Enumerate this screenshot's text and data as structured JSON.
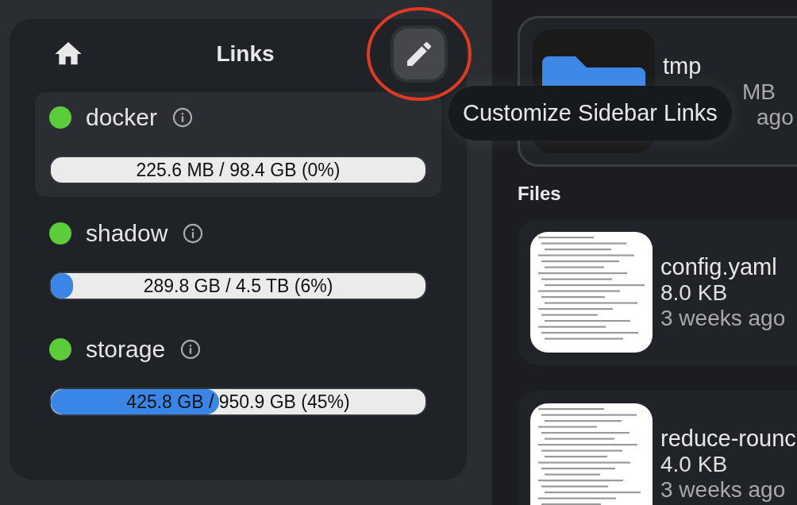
{
  "sidebar": {
    "title": "Links",
    "sources": [
      {
        "name": "docker",
        "online": true,
        "hovered": true,
        "usage": "225.6 MB / 98.4 GB (0%)",
        "level": 0.0
      },
      {
        "name": "shadow",
        "online": true,
        "hovered": false,
        "usage": "289.8 GB / 4.5 TB (6%)",
        "level": 0.06
      },
      {
        "name": "storage",
        "online": true,
        "hovered": false,
        "usage": "425.8 GB / 950.9 GB (45%)",
        "level": 0.45
      }
    ]
  },
  "tooltip": "Customize Sidebar Links",
  "folders": [
    {
      "name": "tmp",
      "size": "MB",
      "modified": "ago"
    }
  ],
  "files_heading": "Files",
  "files": [
    {
      "name": "config.yaml",
      "size": "8.0 KB",
      "modified": "3 weeks ago"
    },
    {
      "name": "reduce-rounc",
      "size": "4.0 KB",
      "modified": "3 weeks ago"
    }
  ]
}
